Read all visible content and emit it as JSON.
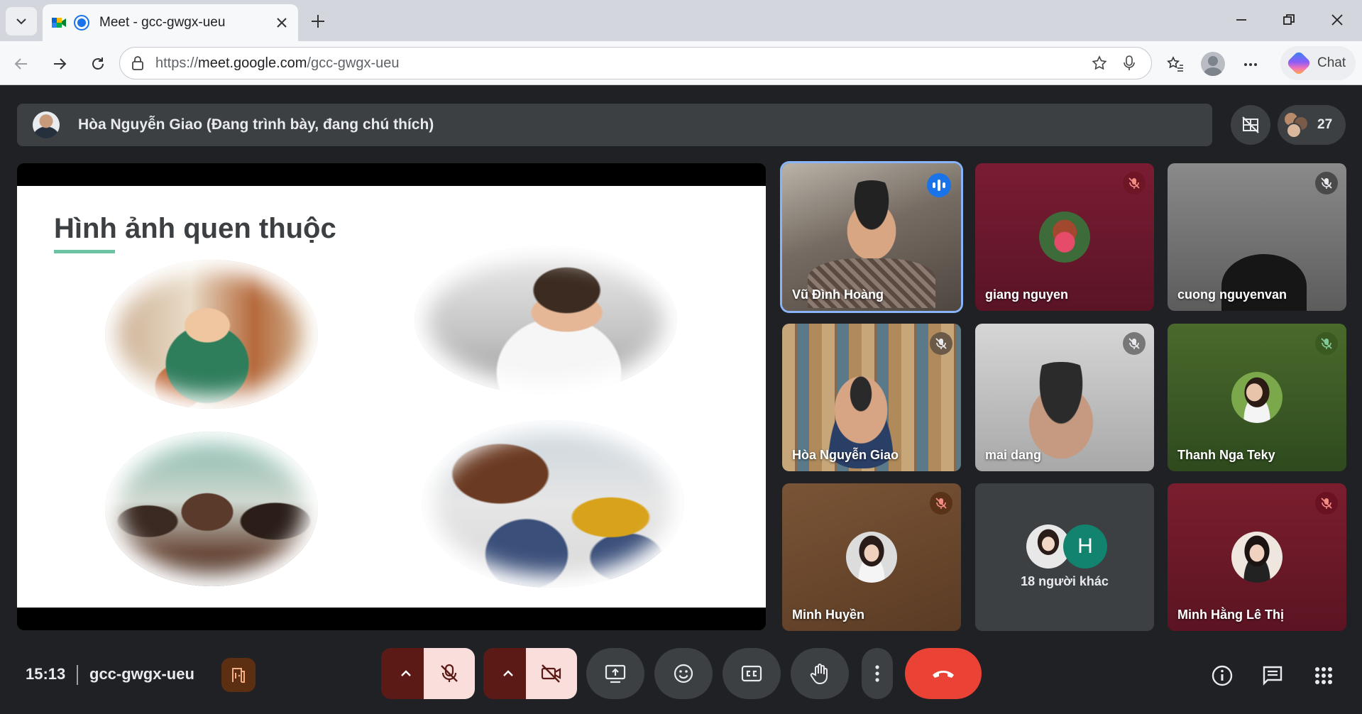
{
  "browser": {
    "tab_title": "Meet - gcc-gwgx-ueu",
    "url_prefix": "https://",
    "url_host": "meet.google.com",
    "url_path": "/gcc-gwgx-ueu",
    "chat_label": "Chat"
  },
  "meet": {
    "presenter_banner": "Hòa Nguyễn Giao (Đang trình bày, đang chú thích)",
    "participant_count": "27",
    "slide_title": "Hình ảnh quen thuộc",
    "tiles": [
      {
        "name": "Vũ Đình Hoàng"
      },
      {
        "name": "giang nguyen"
      },
      {
        "name": "cuong nguyenvan"
      },
      {
        "name": "Hòa Nguyễn Giao"
      },
      {
        "name": "mai dang"
      },
      {
        "name": "Thanh Nga Teky"
      },
      {
        "name": "Minh Huyền"
      },
      {
        "name": "18 người khác",
        "avatar_letter": "H"
      },
      {
        "name": "Minh Hằng Lê Thị"
      }
    ],
    "clock": "15:13",
    "meeting_code": "gcc-gwgx-ueu"
  },
  "colors": {
    "accent": "#1a73e8",
    "end_call": "#ea4335",
    "mute_red": "#f28b82",
    "unmuted_green": "#81c995"
  }
}
